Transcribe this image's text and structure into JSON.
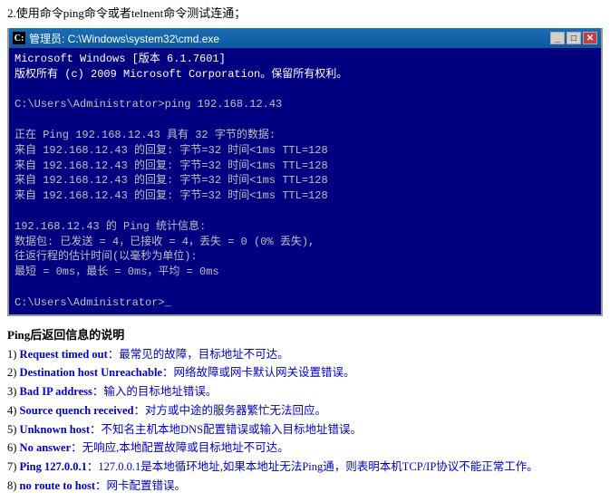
{
  "top_instruction": "2.使用命令ping命令或者telnent命令测试连通；",
  "cmd": {
    "title": "管理员: C:\\Windows\\system32\\cmd.exe",
    "title_icon": "C:",
    "lines": [
      "Microsoft Windows [版本 6.1.7601]",
      "版权所有 (c) 2009 Microsoft Corporation。保留所有权利。",
      "",
      "C:\\Users\\Administrator>ping 192.168.12.43",
      "",
      "正在 Ping 192.168.12.43 具有 32 字节的数据:",
      "来自 192.168.12.43 的回复: 字节=32 时间<1ms TTL=128",
      "来自 192.168.12.43 的回复: 字节=32 时间<1ms TTL=128",
      "来自 192.168.12.43 的回复: 字节=32 时间<1ms TTL=128",
      "来自 192.168.12.43 的回复: 字节=32 时间<1ms TTL=128",
      "",
      "192.168.12.43 的 Ping 统计信息:",
      "    数据包: 已发送 = 4，已接收 = 4，丢失 = 0 (0% 丢失),",
      "往返行程的估计时间(以毫秒为单位):",
      "    最短 = 0ms，最长 = 0ms，平均 = 0ms",
      "",
      "C:\\Users\\Administrator>_"
    ]
  },
  "ping_section": {
    "title": "Ping后返回信息的说明",
    "items": [
      {
        "num": "1)",
        "key": "Request timed out",
        "desc": "：最常见的故障，目标地址不可达。"
      },
      {
        "num": "2)",
        "key": "Destination host Unreachable",
        "desc": "：网络故障或网卡默认网关设置错误。"
      },
      {
        "num": "3)",
        "key": "Bad IP address",
        "desc": "：输入的目标地址错误。"
      },
      {
        "num": "4)",
        "key": "Source quench received",
        "desc": "：对方或中途的服务器繁忙无法回应。"
      },
      {
        "num": "5)",
        "key": "Unknown host",
        "desc": "：不知名主机本地DNS配置错误或输入目标地址错误。"
      },
      {
        "num": "6)",
        "key": "No answer",
        "desc": "：无响应,本地配置故障或目标地址不可达。"
      },
      {
        "num": "7)",
        "key": "Ping 127.0.0.1",
        "desc": "：127.0.0.1是本地循环地址,如果本地址无法Ping通，则表明本机TCP/IP协议不能正常工作。"
      },
      {
        "num": "8)",
        "key": "no route to host",
        "desc": "：网卡配置错误。"
      }
    ]
  }
}
